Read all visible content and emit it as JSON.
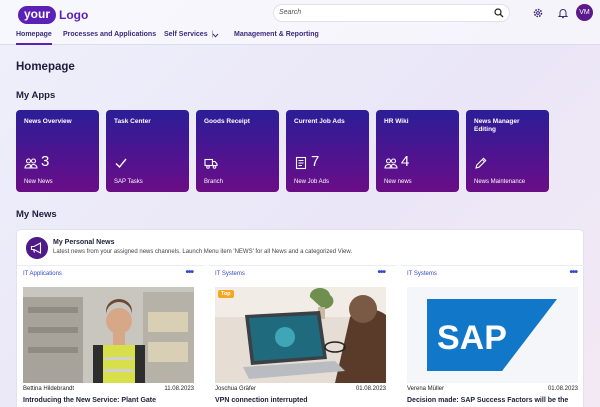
{
  "header": {
    "logo_primary": "your",
    "logo_secondary": "Logo",
    "search_placeholder": "Search",
    "user_initials": "VM",
    "icons": [
      "search-icon",
      "gear-icon",
      "bell-icon"
    ],
    "accent_color": "#5b21b6"
  },
  "nav": {
    "items": [
      {
        "label": "Homepage",
        "active": true
      },
      {
        "label": "Processes and Applications"
      },
      {
        "label": "Self Services"
      },
      {
        "label": "Management & Reporting"
      }
    ],
    "self_services_separator": "|"
  },
  "page": {
    "title": "Homepage",
    "my_apps_title": "My Apps",
    "my_news_title": "My News"
  },
  "apps": [
    {
      "title": "News Overview",
      "icon": "people-icon",
      "count": "3",
      "footer": "New News"
    },
    {
      "title": "Task Center",
      "icon": "check-icon",
      "count": "",
      "footer": "SAP Tasks"
    },
    {
      "title": "Goods Receipt",
      "icon": "truck-icon",
      "count": "",
      "footer": "Branch"
    },
    {
      "title": "Current Job Ads",
      "icon": "document-icon",
      "count": "7",
      "footer": "New Job Ads"
    },
    {
      "title": "HR Wiki",
      "icon": "people-icon",
      "count": "4",
      "footer": "New news"
    },
    {
      "title": "News Manager Editing",
      "icon": "edit-icon",
      "count": "",
      "footer": "News Maintenance"
    }
  ],
  "news": {
    "header_title": "My Personal News",
    "header_desc": "Latest news from your assigned news channels. Launch Menu item 'NEWS' for all News and a categorized View.",
    "columns": [
      {
        "category": "IT Applications",
        "author": "Bettina Hildebrandt",
        "date": "11.08.2023",
        "headline": "Introducing the New Service: Plant Gate",
        "badge": ""
      },
      {
        "category": "IT Systems",
        "author": "Joschua Gräfer",
        "date": "01.08.2023",
        "headline": "VPN connection interrupted",
        "badge": "Top"
      },
      {
        "category": "IT Systems",
        "author": "Verena Müller",
        "date": "01.08.2023",
        "headline": "Decision made: SAP Success Factors will be the",
        "badge": "",
        "image_text": "SAP"
      }
    ]
  }
}
